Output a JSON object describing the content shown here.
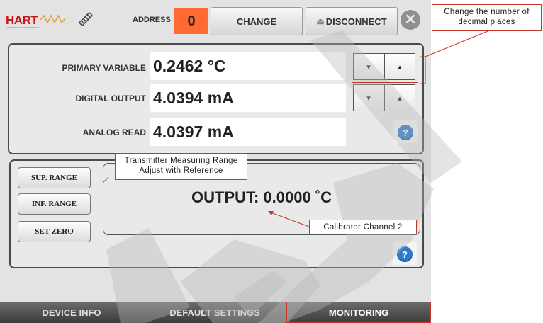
{
  "header": {
    "logo_text": "HART",
    "logo_subtext": "COMMUNICATION PROTOCOL",
    "address_label": "ADDRESS",
    "address_value": "0",
    "change_label": "CHANGE",
    "disconnect_label": "DISCONNECT",
    "close_symbol": "✕"
  },
  "readings": [
    {
      "label": "PRIMARY VARIABLE",
      "value": "0.2462 °C"
    },
    {
      "label": "DIGITAL OUTPUT",
      "value": "4.0394 mA"
    },
    {
      "label": "ANALOG READ",
      "value": "4.0397 mA"
    }
  ],
  "arrows": {
    "down": "▾",
    "up": "▴"
  },
  "help_symbol": "?",
  "range_buttons": {
    "sup": "SUP. RANGE",
    "inf": "INF. RANGE",
    "zero": "SET ZERO"
  },
  "output_text": "OUTPUT: 0.0000 ˚C",
  "tabs": [
    {
      "label": "DEVICE INFO",
      "active": false
    },
    {
      "label": "DEFAULT SETTINGS",
      "active": false
    },
    {
      "label": "MONITORING",
      "active": true
    }
  ],
  "annotations": {
    "decimal_places": "Change the number of decimal places",
    "range_adjust_line1": "Transmitter Measuring Range",
    "range_adjust_line2": "Adjust with Reference",
    "calibrator": "Calibrator Channel 2"
  },
  "colors": {
    "address_bg": "#ff6a33",
    "annotation_red": "#c0392b",
    "help_blue": "#2f7ac9"
  }
}
